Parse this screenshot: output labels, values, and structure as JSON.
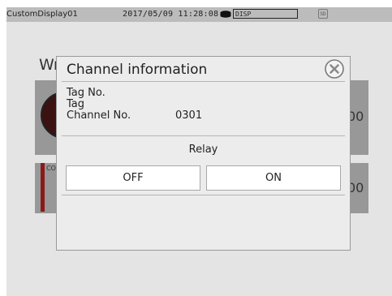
{
  "status_bar": {
    "title": "CustomDisplay01",
    "datetime": "2017/05/09 11:28:08",
    "disp_label": "DISP",
    "sd_label": "SD",
    "disk_icon": "disk-icon"
  },
  "background": {
    "title_fragment": "Wr",
    "value1_fragment": "00",
    "value2_fragment": "00",
    "card_label_fragment": "CO"
  },
  "dialog": {
    "title": "Channel information",
    "close_icon": "close-circle-icon",
    "tag_no_label": "Tag No.",
    "tag_label": "Tag",
    "channel_no_label": "Channel No.",
    "channel_no_value": "0301",
    "relay_label": "Relay",
    "off_button": "OFF",
    "on_button": "ON"
  },
  "colors": {
    "status_bar_bg": "#bcbcbc",
    "dialog_bg": "#ececec",
    "dim_card": "#989898",
    "alarm_red": "#8a1a1a"
  }
}
